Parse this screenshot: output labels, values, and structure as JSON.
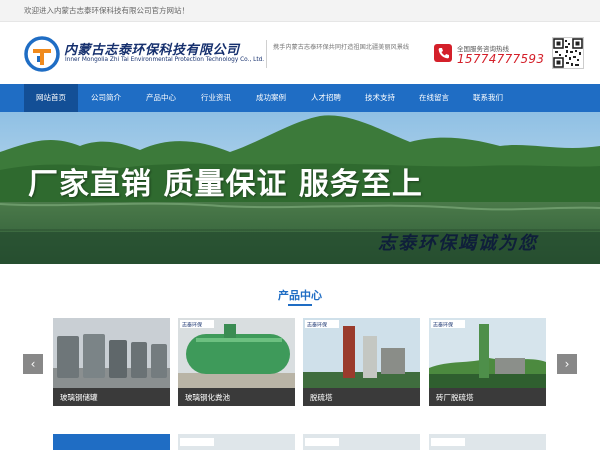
{
  "topbar": {
    "welcome": "欢迎进入内蒙古志泰环保科技有限公司官方网站！"
  },
  "header": {
    "company_cn": "内蒙古志泰环保科技有限公司",
    "company_en": "Inner Mongolia Zhi Tai Environmental Protection Technology Co., Ltd.",
    "slogan": "携手内蒙古志泰环保共同打造祖国北疆美丽风景线",
    "phone_label": "全国服务咨询热线",
    "phone_number": "15774777593",
    "logo_icon": "logo-icon",
    "phone_icon": "phone-icon",
    "qr_icon": "qr-code-icon"
  },
  "nav": {
    "items": [
      {
        "label": "网站首页",
        "active": true
      },
      {
        "label": "公司简介"
      },
      {
        "label": "产品中心"
      },
      {
        "label": "行业资讯"
      },
      {
        "label": "成功案例"
      },
      {
        "label": "人才招聘"
      },
      {
        "label": "技术支持"
      },
      {
        "label": "在线留言"
      },
      {
        "label": "联系我们"
      }
    ]
  },
  "banner": {
    "headline": "厂家直销  质量保证  服务至上",
    "subline": "志泰环保竭诚为您"
  },
  "products": {
    "title": "产品中心",
    "prev_icon": "chevron-left-icon",
    "next_icon": "chevron-right-icon",
    "items": [
      {
        "label": "玻璃钢储罐"
      },
      {
        "label": "玻璃钢化粪池"
      },
      {
        "label": "脱硫塔"
      },
      {
        "label": "砖厂脱硫塔"
      }
    ]
  },
  "colors": {
    "brand_blue": "#1f6dc4",
    "phone_red": "#d4202a",
    "caption_bg": "#3a3a3a"
  }
}
